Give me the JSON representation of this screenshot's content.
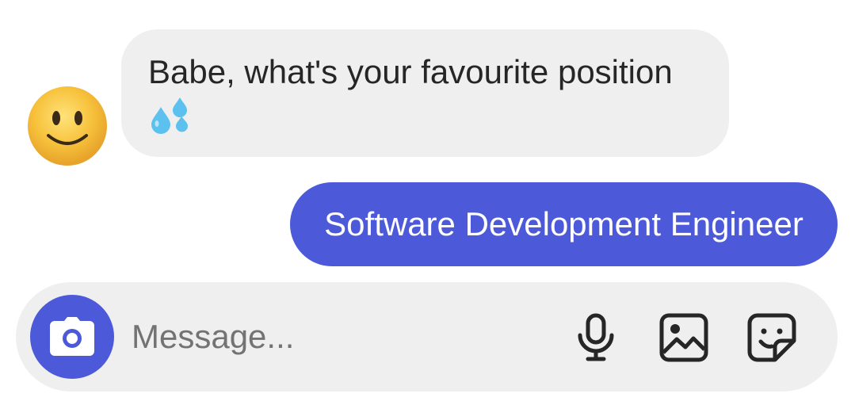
{
  "thread": {
    "incoming": {
      "avatar_icon": "slightly-smiling-face-emoji",
      "text": "Babe, what's your favourite position",
      "emoji_icon": "sweat-droplets-emoji"
    },
    "outgoing": {
      "text": "Software Development Engineer"
    }
  },
  "composer": {
    "placeholder": "Message...",
    "value": "",
    "icons": {
      "camera": "camera-icon",
      "mic": "microphone-icon",
      "gallery": "image-gallery-icon",
      "sticker": "sticker-icon"
    }
  },
  "colors": {
    "accent": "#4c5ad9",
    "incoming_bubble": "#efefef",
    "composer_bg": "#efefef",
    "text_dark": "#262626",
    "placeholder": "#737373"
  }
}
